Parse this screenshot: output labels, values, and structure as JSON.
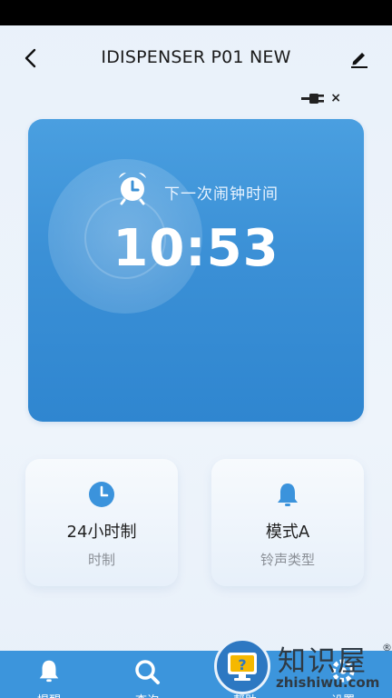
{
  "header": {
    "title": "IDISPENSER P01 NEW"
  },
  "connection": {
    "status_icon": "plug-disconnected-icon",
    "status_mark": "×"
  },
  "alarm": {
    "label": "下一次闹钟时间",
    "time": "10:53"
  },
  "tiles": [
    {
      "value": "24小时制",
      "label": "时制",
      "icon": "clock-icon"
    },
    {
      "value": "模式A",
      "label": "铃声类型",
      "icon": "bell-icon"
    }
  ],
  "nav": {
    "items": [
      {
        "label": "提醒",
        "icon": "bell-icon"
      },
      {
        "label": "查询",
        "icon": "search-icon"
      },
      {
        "label": "帮助",
        "icon": "help-icon"
      },
      {
        "label": "设置",
        "icon": "settings-icon"
      }
    ]
  },
  "watermark": {
    "title": "知识屋",
    "reg": "®",
    "url": "zhishiwu.com"
  },
  "colors": {
    "accent": "#3c95dc",
    "card": "#3b90d6",
    "status_bar": "#000000"
  }
}
